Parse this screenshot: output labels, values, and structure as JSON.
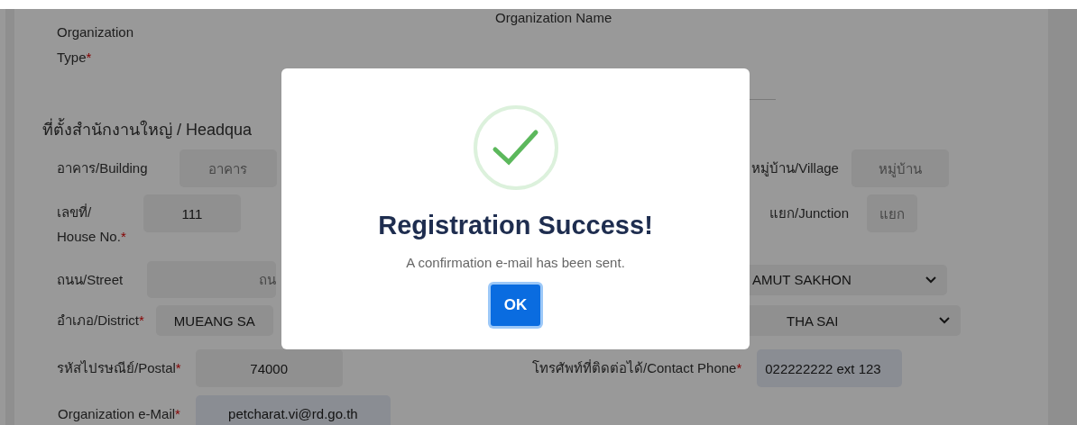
{
  "form": {
    "organization_type": {
      "label": "Organization Type",
      "required_mark": "*"
    },
    "organization_name": {
      "label": "Organization Name"
    },
    "section_heading": "ที่ตั้งสำนักงานใหญ่ / Headqua",
    "building": {
      "label": "อาคาร/Building",
      "placeholder": "อาคาร"
    },
    "village": {
      "label": "หมู่บ้าน/Village",
      "placeholder": "หมู่บ้าน"
    },
    "house_no": {
      "label": "เลขที่/ House No.",
      "required_mark": "*",
      "value": "111"
    },
    "junction": {
      "label": "แยก/Junction",
      "placeholder": "แยก"
    },
    "street": {
      "label": "ถนน/Street",
      "placeholder": "ถน"
    },
    "province": {
      "value": "AMUT SAKHON"
    },
    "district": {
      "label": "อำเภอ/District",
      "required_mark": "*",
      "value": "MUEANG SA"
    },
    "subdistrict": {
      "value": "THA SAI"
    },
    "postal": {
      "label": "รหัสไปรษณีย์/Postal",
      "required_mark": "*",
      "value": "74000"
    },
    "phone": {
      "label": "โทรศัพท์ที่ติดต่อได้/Contact Phone",
      "required_mark": "*",
      "value": "022222222 ext 123"
    },
    "email": {
      "label": "Organization e-Mail",
      "required_mark": "*",
      "value": "petcharat.vi@rd.go.th"
    }
  },
  "dialog": {
    "title": "Registration Success!",
    "message": "A confirmation e-mail has been sent.",
    "button": "OK"
  }
}
